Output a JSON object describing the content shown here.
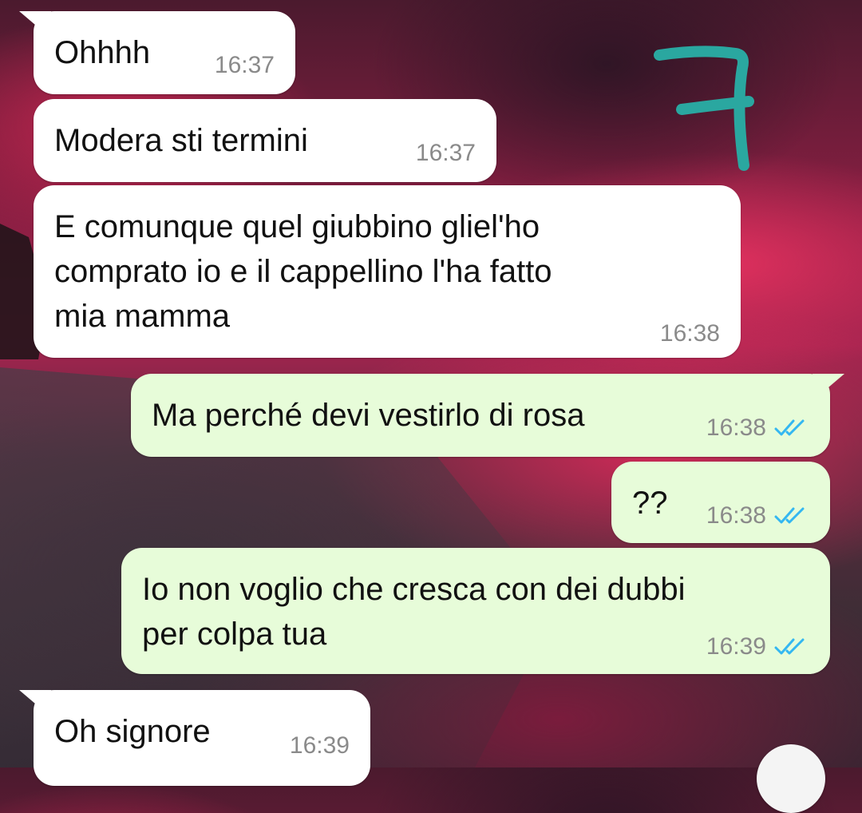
{
  "chat": {
    "messages": [
      {
        "direction": "in",
        "text": "Ohhhh",
        "time": "16:37"
      },
      {
        "direction": "in",
        "text": "Modera sti termini",
        "time": "16:37"
      },
      {
        "direction": "in",
        "text": "E comunque quel giubbino gliel'ho\ncomprato io e il cappellino l'ha fatto\nmia mamma",
        "time": "16:38"
      },
      {
        "direction": "out",
        "text": "Ma perché devi vestirlo di rosa",
        "time": "16:38",
        "status": "read"
      },
      {
        "direction": "out",
        "text": "??",
        "time": "16:38",
        "status": "read"
      },
      {
        "direction": "out",
        "text": "Io non voglio che cresca con dei dubbi\nper colpa tua",
        "time": "16:39",
        "status": "read"
      },
      {
        "direction": "in",
        "text": "Oh signore",
        "time": "16:39"
      }
    ]
  },
  "annotation": {
    "text": "7",
    "color": "#2aa7a0"
  },
  "colors": {
    "incoming_bubble": "#ffffff",
    "outgoing_bubble": "#e7fcd9",
    "read_ticks": "#34b7f1",
    "timestamp": "#8a8a8a"
  },
  "icons": {
    "read_receipt": "double-check-icon",
    "scroll_button": "chevron-down-icon"
  }
}
